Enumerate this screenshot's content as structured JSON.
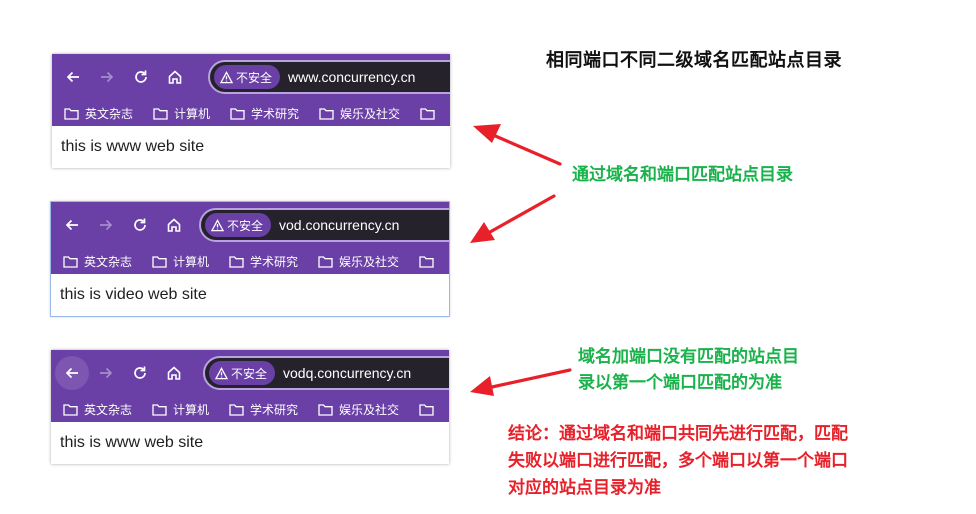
{
  "heading": "相同端口不同二级域名匹配站点目录",
  "security_label": "不安全",
  "bookmarks": [
    "英文杂志",
    "计算机",
    "学术研究",
    "娱乐及社交"
  ],
  "browsers": [
    {
      "url": "www.concurrency.cn",
      "content": "this is www web site"
    },
    {
      "url": "vod.concurrency.cn",
      "content": "this is video web site"
    },
    {
      "url": "vodq.concurrency.cn",
      "content": "this is www web site"
    }
  ],
  "notes": {
    "match": "通过域名和端口匹配站点目录",
    "fallback_line1": "域名加端口没有匹配的站点目",
    "fallback_line2": "录以第一个端口匹配的为准",
    "conclusion_line1": "结论：通过域名和端口共同先进行匹配，匹配",
    "conclusion_line2": "失败以端口进行匹配，多个端口以第一个端口",
    "conclusion_line3": "对应的站点目录为准"
  },
  "colors": {
    "toolbar": "#6a3fa6",
    "omnibox": "#25222b",
    "green_note": "#19b24b",
    "red_note": "#e8202a",
    "arrow": "#e8202a"
  },
  "icons": [
    "back-icon",
    "forward-icon",
    "reload-icon",
    "home-icon",
    "warning-icon",
    "folder-icon"
  ]
}
